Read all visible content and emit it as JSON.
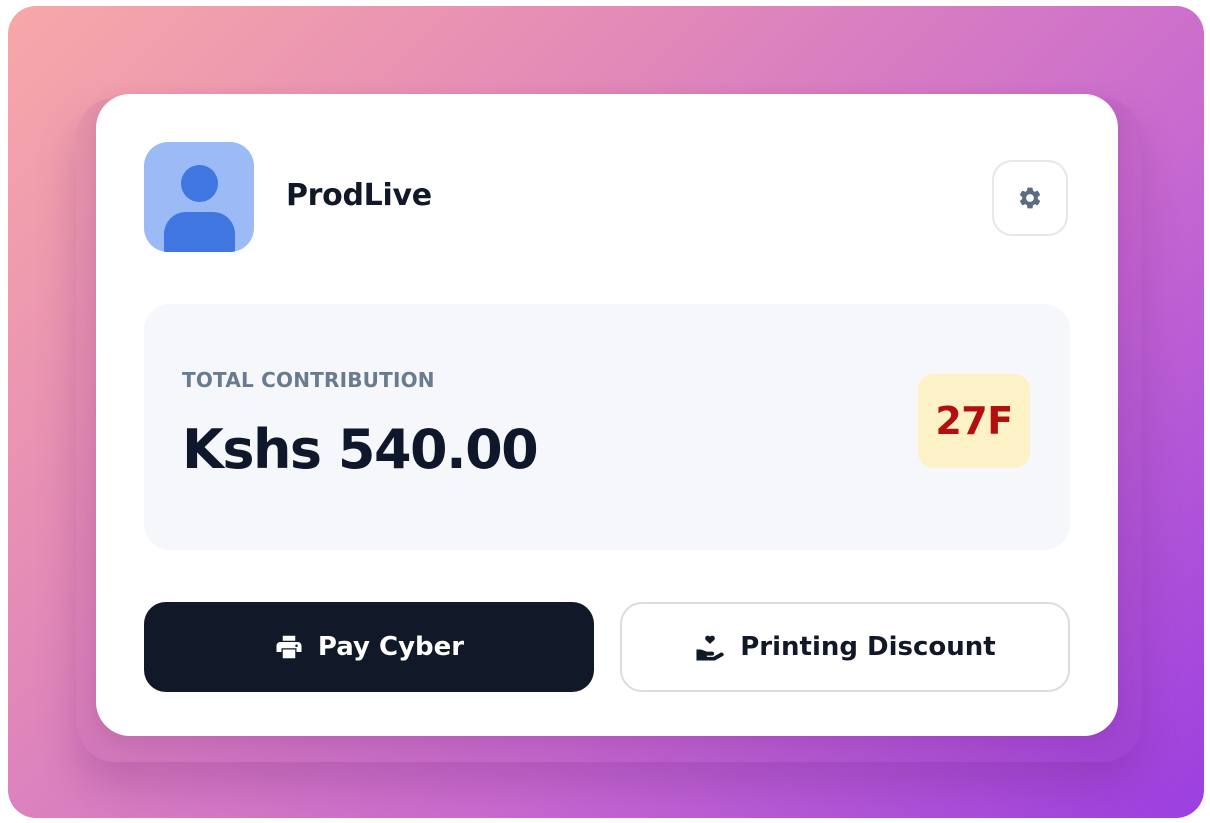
{
  "profile": {
    "name": "ProdLive",
    "avatar_icon": "user-avatar-icon"
  },
  "settings": {
    "icon": "gear-icon"
  },
  "summary": {
    "label": "TOTAL CONTRIBUTION",
    "amount": "Kshs 540.00",
    "badge": "27F"
  },
  "actions": {
    "pay_label": "Pay Cyber",
    "pay_icon": "printer-icon",
    "discount_label": "Printing Discount",
    "discount_icon": "hand-heart-icon"
  },
  "colors": {
    "badge_text": "#b30f0f",
    "badge_bg": "#fdf1c7",
    "primary_button": "#111827",
    "avatar_bg": "#9cbaf5",
    "avatar_fg": "#3f76e0"
  }
}
